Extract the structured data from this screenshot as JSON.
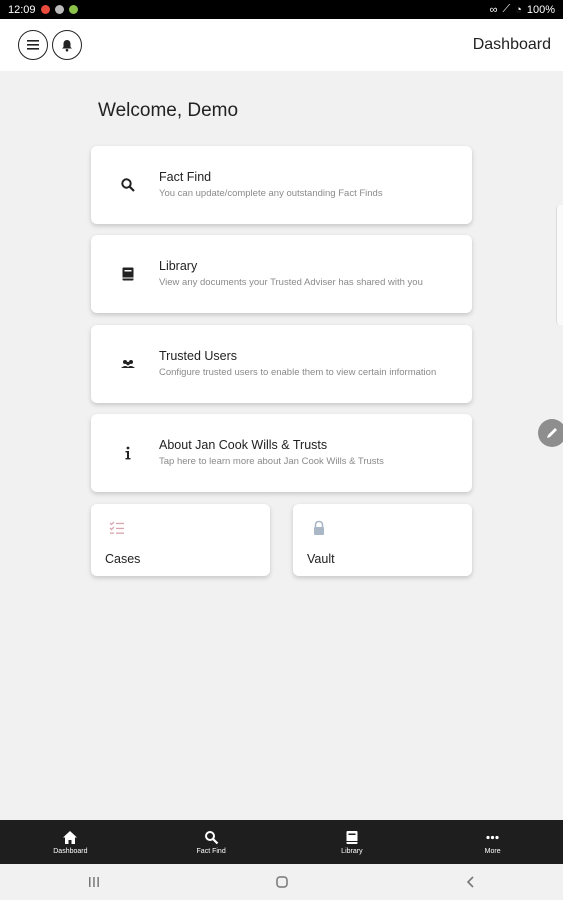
{
  "status_bar": {
    "time": "12:09",
    "battery": "100%"
  },
  "app_bar": {
    "title": "Dashboard",
    "menu_icon": "menu-icon",
    "bell_icon": "bell-icon"
  },
  "welcome": "Welcome, Demo",
  "cards": [
    {
      "title": "Fact Find",
      "subtitle": "You can update/complete any outstanding Fact Finds",
      "icon": "search-icon"
    },
    {
      "title": "Library",
      "subtitle": "View any documents your Trusted Adviser has shared with you",
      "icon": "book-icon"
    },
    {
      "title": "Trusted Users",
      "subtitle": "Configure trusted users to enable them to view certain information",
      "icon": "users-icon"
    },
    {
      "title": "About Jan Cook Wills & Trusts",
      "subtitle": "Tap here to learn more about Jan Cook Wills & Trusts",
      "icon": "info-icon"
    }
  ],
  "tiles": [
    {
      "label": "Cases",
      "icon": "checklist-icon",
      "icon_color": "#d9a4ae"
    },
    {
      "label": "Vault",
      "icon": "lock-icon",
      "icon_color": "#a9b7c6"
    }
  ],
  "bottom_nav": [
    {
      "label": "Dashboard",
      "icon": "home-icon"
    },
    {
      "label": "Fact Find",
      "icon": "search-icon"
    },
    {
      "label": "Library",
      "icon": "book-icon"
    },
    {
      "label": "More",
      "icon": "more-icon"
    }
  ],
  "colors": {
    "background": "#f1f1f1",
    "nav_bar": "#1e1e1e",
    "subtitle": "#8a8a8a"
  }
}
